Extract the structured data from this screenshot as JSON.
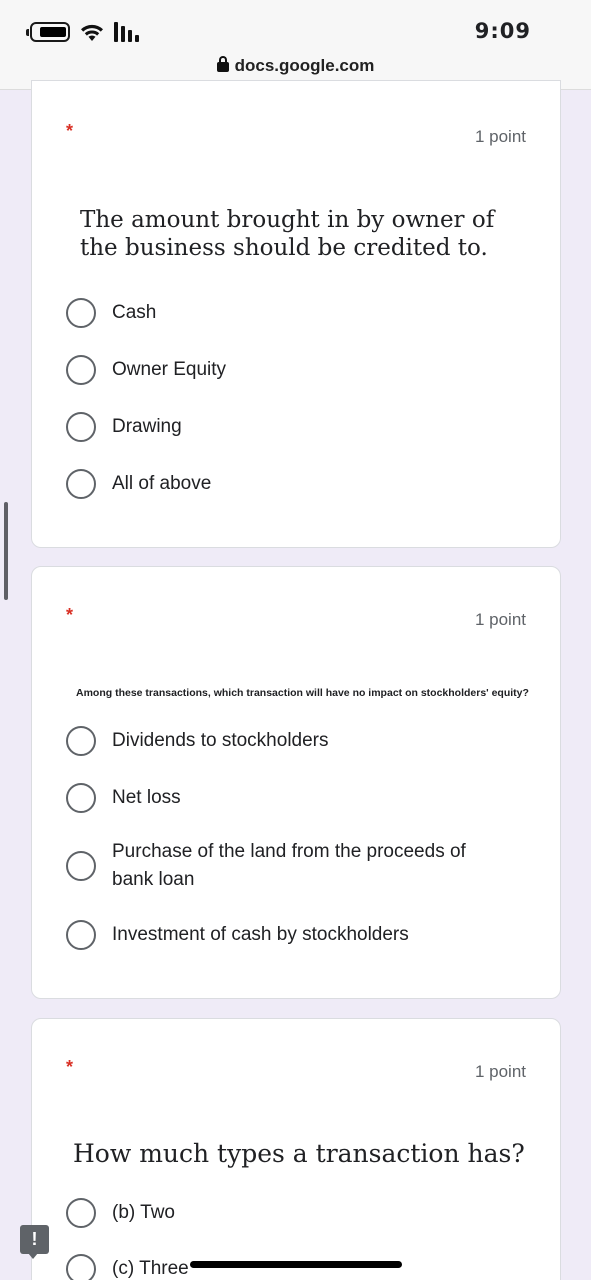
{
  "status_bar": {
    "time": "9:09",
    "battery_icon": "battery-icon",
    "wifi_icon": "wifi-icon",
    "signal_icon": "signal-icon"
  },
  "browser": {
    "url": "docs.google.com",
    "lock_icon": "lock-icon"
  },
  "questions": [
    {
      "required_mark": "*",
      "points": "1 point",
      "text": "The amount brought in by owner of the business should be credited to.",
      "options": [
        "Cash",
        "Owner Equity",
        "Drawing",
        "All of above"
      ]
    },
    {
      "required_mark": "*",
      "points": "1 point",
      "text": "Among these transactions, which transaction will have no impact on stockholders' equity?",
      "options": [
        "Dividends to stockholders",
        "Net loss",
        "Purchase of the land from the proceeds of bank loan",
        "Investment of cash by stockholders"
      ]
    },
    {
      "required_mark": "*",
      "points": "1 point",
      "text": "How much types a transaction has?",
      "options": [
        "(b) Two",
        "(c) Three"
      ]
    }
  ],
  "feedback": {
    "label": "!",
    "icon": "feedback-icon"
  },
  "colors": {
    "background": "#efebf7",
    "required": "#d93025",
    "radio_border": "#5f6368"
  }
}
